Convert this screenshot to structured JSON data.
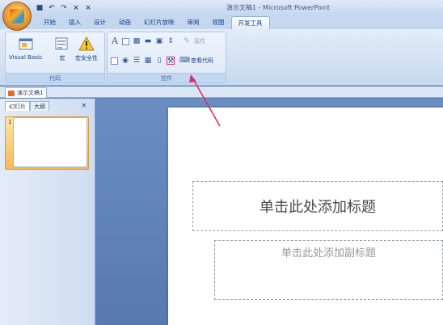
{
  "window": {
    "title": "演示文稿1 - Microsoft PowerPoint"
  },
  "quick_access": [
    "save-icon",
    "undo-icon",
    "redo-icon",
    "close-icon",
    "close-icon"
  ],
  "tabs": [
    {
      "label": "开始"
    },
    {
      "label": "插入"
    },
    {
      "label": "设计"
    },
    {
      "label": "动画"
    },
    {
      "label": "幻灯片放映"
    },
    {
      "label": "审阅"
    },
    {
      "label": "视图"
    },
    {
      "label": "开发工具",
      "active": true
    }
  ],
  "ribbon": {
    "code_group": {
      "label": "代码",
      "visual_basic": "Visual Basic",
      "macro": "宏",
      "macro_security": "宏安全性"
    },
    "controls_group": {
      "label": "控件",
      "properties": "属性",
      "view_code": "查看代码"
    }
  },
  "document_tab": "演示文稿1",
  "left_pane": {
    "tabs": [
      "幻灯片",
      "大纲"
    ],
    "slide_number": "1"
  },
  "slide": {
    "title_placeholder": "单击此处添加标题",
    "subtitle_placeholder": "单击此处添加副标题"
  },
  "colors": {
    "accent_arrow": "#e0305f",
    "ribbon_bg": "#d3e1f3",
    "editor_bg": "#5d7fb5"
  }
}
